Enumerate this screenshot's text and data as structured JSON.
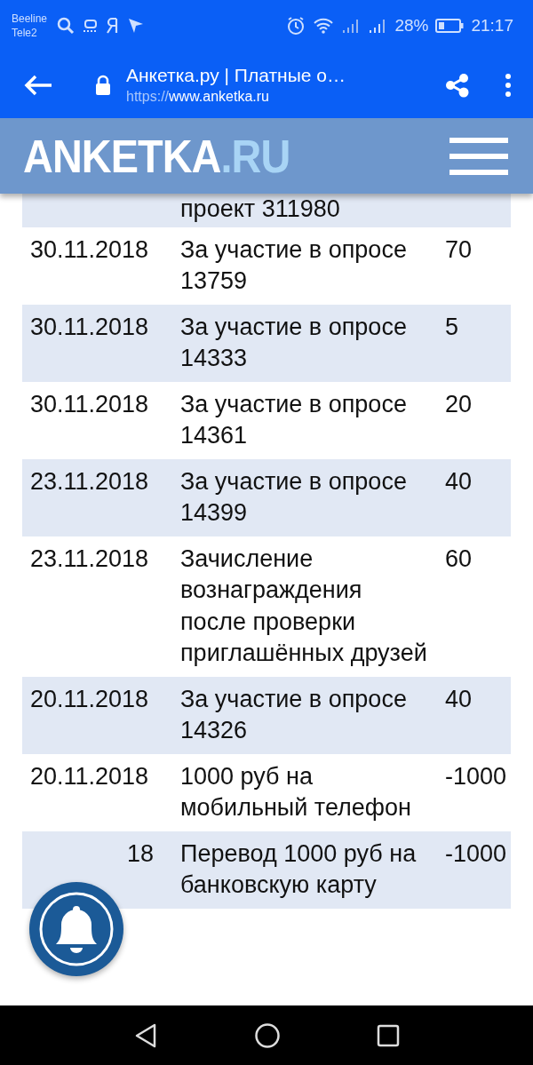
{
  "status_bar": {
    "carriers": [
      "Beeline",
      "Tele2"
    ],
    "battery_text": "28%",
    "time": "21:17"
  },
  "browser": {
    "title": "Анкетка.ру | Платные о…",
    "url_scheme": "https://",
    "url_host": "www.anketka.ru"
  },
  "site_header": {
    "logo_main": "ANKETKA",
    "logo_suffix": ".RU"
  },
  "transactions": [
    {
      "description": "проект 311980"
    },
    {
      "date": "30.11.2018",
      "description": "За участие в опросе 13759",
      "amount": "70"
    },
    {
      "date": "30.11.2018",
      "description": "За участие в опросе 14333",
      "amount": "5"
    },
    {
      "date": "30.11.2018",
      "description": "За участие в опросе 14361",
      "amount": "20"
    },
    {
      "date": "23.11.2018",
      "description": "За участие в опросе 14399",
      "amount": "40"
    },
    {
      "date": "23.11.2018",
      "description": "Зачисление вознаграждения после проверки приглашённых друзей",
      "amount": "60"
    },
    {
      "date": "20.11.2018",
      "description": "За участие в опросе 14326",
      "amount": "40"
    },
    {
      "date": "20.11.2018",
      "description": "1000 руб на мобильный телефон",
      "amount": "-1000"
    },
    {
      "date": "18",
      "date_partial": true,
      "description": "Перевод 1000 руб на банковскую карту",
      "amount": "-1000"
    }
  ]
}
